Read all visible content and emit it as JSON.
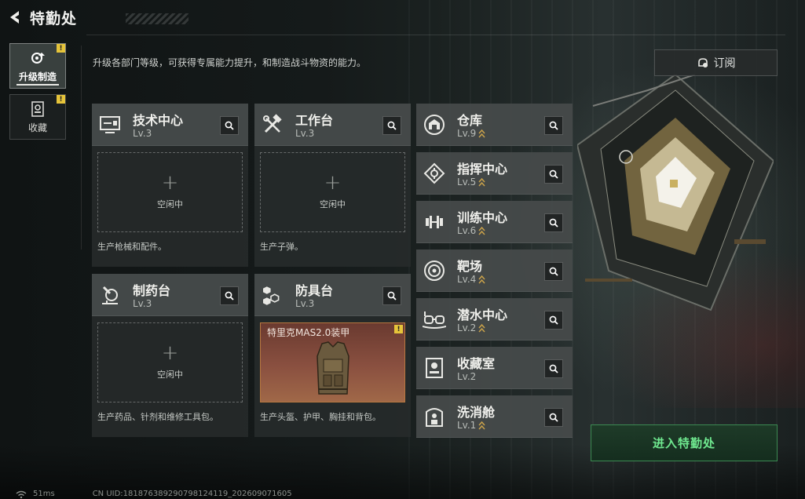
{
  "header": {
    "title": "特勤处"
  },
  "sidebar": {
    "tabs": [
      {
        "label": "升级制造",
        "active": true,
        "alert": "!"
      },
      {
        "label": "收藏",
        "active": false,
        "alert": "!"
      }
    ]
  },
  "description": "升级各部门等级，可获得专属能力提升，和制造战斗物资的能力。",
  "subscribe": {
    "label": "订阅"
  },
  "production": [
    {
      "name": "技术中心",
      "level": "Lv.3",
      "slot": {
        "plus": "+",
        "label": "空闲中"
      },
      "desc": "生产枪械和配件。",
      "icon": "tech-center-icon"
    },
    {
      "name": "工作台",
      "level": "Lv.3",
      "slot": {
        "plus": "+",
        "label": "空闲中"
      },
      "desc": "生产子弹。",
      "icon": "workbench-icon"
    },
    {
      "name": "制药台",
      "level": "Lv.3",
      "slot": {
        "plus": "+",
        "label": "空闲中"
      },
      "desc": "生产药品、针剂和维修工具包。",
      "icon": "pharmacy-icon"
    },
    {
      "name": "防具台",
      "level": "Lv.3",
      "slot": {
        "item": "特里克MAS2.0装甲",
        "alert": "!"
      },
      "desc": "生产头盔、护甲、胸挂和背包。",
      "icon": "armor-bench-icon"
    }
  ],
  "facilities": [
    {
      "name": "仓库",
      "level": "Lv.9",
      "upgradable": true,
      "icon": "warehouse-icon"
    },
    {
      "name": "指挥中心",
      "level": "Lv.5",
      "upgradable": true,
      "icon": "command-center-icon"
    },
    {
      "name": "训练中心",
      "level": "Lv.6",
      "upgradable": true,
      "icon": "training-center-icon"
    },
    {
      "name": "靶场",
      "level": "Lv.4",
      "upgradable": true,
      "icon": "shooting-range-icon"
    },
    {
      "name": "潜水中心",
      "level": "Lv.2",
      "upgradable": true,
      "icon": "diving-center-icon"
    },
    {
      "name": "收藏室",
      "level": "Lv.2",
      "upgradable": false,
      "icon": "collection-room-icon"
    },
    {
      "name": "洗消舱",
      "level": "Lv.1",
      "upgradable": true,
      "icon": "decon-chamber-icon"
    }
  ],
  "enter_button": {
    "label": "进入特勤处"
  },
  "footer": {
    "ping": "51ms",
    "uid": "CN UID:1818763892907981241​19_202609071605"
  },
  "colors": {
    "accent_green": "#6fe88f",
    "alert_yellow": "#e6c43a",
    "upgrade_gold": "#c9a24a"
  }
}
